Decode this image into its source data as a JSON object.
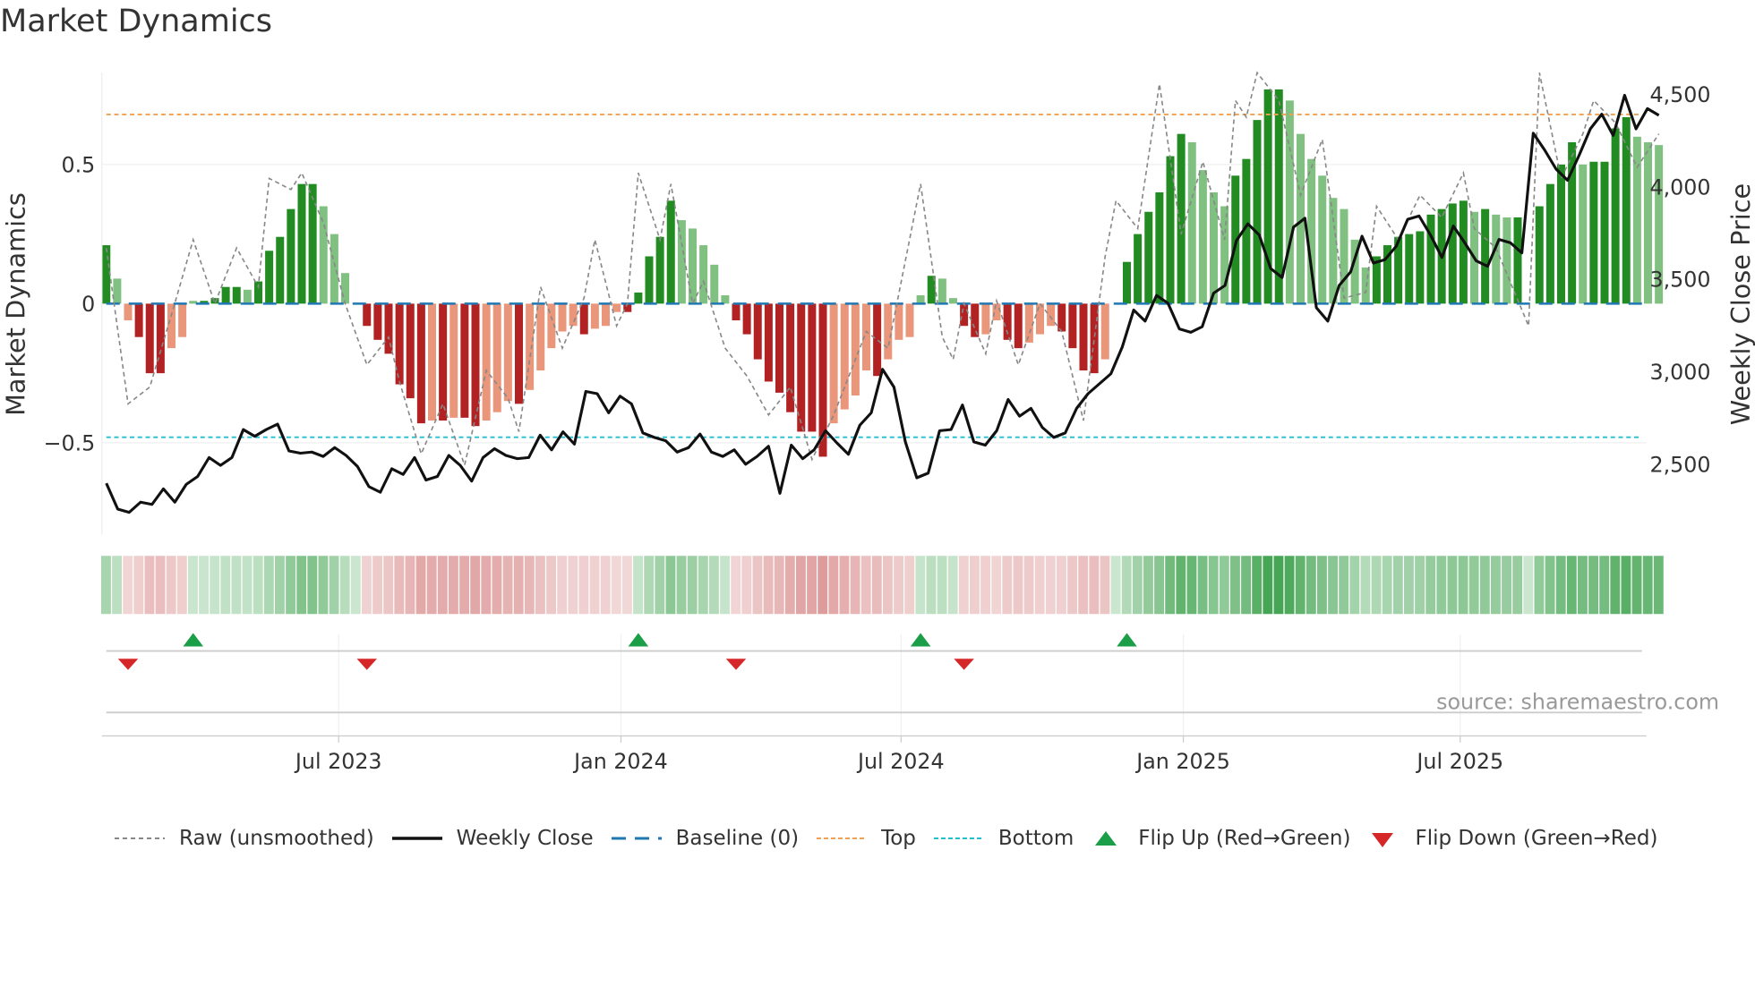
{
  "chart_data": {
    "type": "bar",
    "title": "Market Dynamics",
    "ylabel_left": "Market Dynamics",
    "ylabel_right": "Weekly Close Price",
    "ylim_left": [
      -0.83,
      0.83
    ],
    "ylim_right": [
      2120,
      4615
    ],
    "yticks_left": [
      {
        "v": 0.5,
        "label": "0.5"
      },
      {
        "v": 0,
        "label": "0"
      },
      {
        "v": -0.5,
        "label": "−0.5"
      }
    ],
    "yticks_right": [
      {
        "v": 4500,
        "label": "4,500"
      },
      {
        "v": 4000,
        "label": "4,000"
      },
      {
        "v": 3500,
        "label": "3,500"
      },
      {
        "v": 3000,
        "label": "3,000"
      },
      {
        "v": 2500,
        "label": "2,500"
      }
    ],
    "xticks": [
      {
        "week": 21.4,
        "label": "Jul 2023"
      },
      {
        "week": 47.4,
        "label": "Jan 2024"
      },
      {
        "week": 73.2,
        "label": "Jul 2024"
      },
      {
        "week": 99.2,
        "label": "Jan 2025"
      },
      {
        "week": 124.7,
        "label": "Jul 2025"
      }
    ],
    "top_level": 0.68,
    "bottom_level": -0.48,
    "baseline": 0,
    "momentum": [
      0.21,
      0.09,
      -0.06,
      -0.12,
      -0.25,
      -0.25,
      -0.16,
      -0.12,
      0.01,
      0.01,
      0.02,
      0.06,
      0.06,
      0.05,
      0.08,
      0.19,
      0.24,
      0.34,
      0.43,
      0.43,
      0.35,
      0.25,
      0.11,
      0,
      -0.08,
      -0.13,
      -0.18,
      -0.29,
      -0.34,
      -0.43,
      -0.42,
      -0.42,
      -0.41,
      -0.41,
      -0.44,
      -0.42,
      -0.39,
      -0.35,
      -0.36,
      -0.31,
      -0.24,
      -0.16,
      -0.1,
      -0.08,
      -0.11,
      -0.09,
      -0.08,
      -0.03,
      -0.03,
      0.04,
      0.17,
      0.24,
      0.37,
      0.3,
      0.27,
      0.21,
      0.14,
      0.03,
      -0.06,
      -0.11,
      -0.2,
      -0.28,
      -0.32,
      -0.39,
      -0.46,
      -0.46,
      -0.55,
      -0.43,
      -0.38,
      -0.33,
      -0.24,
      -0.26,
      -0.2,
      -0.13,
      -0.12,
      0.03,
      0.1,
      0.09,
      0.02,
      -0.08,
      -0.12,
      -0.11,
      -0.06,
      -0.13,
      -0.16,
      -0.14,
      -0.11,
      -0.08,
      -0.1,
      -0.16,
      -0.24,
      -0.25,
      -0.2,
      0,
      0.15,
      0.25,
      0.33,
      0.4,
      0.53,
      0.61,
      0.58,
      0.48,
      0.4,
      0.35,
      0.46,
      0.52,
      0.66,
      0.77,
      0.77,
      0.73,
      0.61,
      0.52,
      0.46,
      0.38,
      0.34,
      0.23,
      0.13,
      0.17,
      0.21,
      0.24,
      0.25,
      0.26,
      0.32,
      0.34,
      0.36,
      0.37,
      0.33,
      0.34,
      0.32,
      0.31,
      0.31,
      0.0,
      0.35,
      0.43,
      0.5,
      0.58,
      0.5,
      0.51,
      0.51,
      0.63,
      0.67,
      0.6,
      0.58,
      0.57
    ],
    "weekly_close": [
      2397,
      2258,
      2240,
      2295,
      2283,
      2367,
      2295,
      2391,
      2434,
      2536,
      2494,
      2536,
      2687,
      2651,
      2687,
      2717,
      2572,
      2560,
      2566,
      2542,
      2590,
      2548,
      2488,
      2379,
      2349,
      2476,
      2445,
      2536,
      2415,
      2434,
      2548,
      2494,
      2409,
      2536,
      2584,
      2548,
      2530,
      2536,
      2657,
      2578,
      2675,
      2609,
      2893,
      2881,
      2778,
      2868,
      2826,
      2669,
      2645,
      2627,
      2566,
      2590,
      2663,
      2566,
      2542,
      2578,
      2500,
      2542,
      2597,
      2343,
      2603,
      2530,
      2578,
      2681,
      2615,
      2554,
      2711,
      2778,
      3013,
      2917,
      2621,
      2427,
      2452,
      2681,
      2687,
      2820,
      2621,
      2603,
      2681,
      2850,
      2760,
      2802,
      2699,
      2645,
      2669,
      2802,
      2881,
      2935,
      2989,
      3134,
      3333,
      3273,
      3412,
      3370,
      3231,
      3213,
      3243,
      3424,
      3466,
      3708,
      3799,
      3738,
      3557,
      3509,
      3781,
      3829,
      3346,
      3273,
      3466,
      3539,
      3732,
      3587,
      3605,
      3678,
      3823,
      3841,
      3738,
      3617,
      3787,
      3696,
      3599,
      3569,
      3714,
      3696,
      3642,
      4288,
      4197,
      4094,
      4034,
      4167,
      4312,
      4391,
      4276,
      4493,
      4312,
      4421,
      4385
    ],
    "raw": [
      [
        0,
        0.2
      ],
      [
        2,
        -0.36
      ],
      [
        4,
        -0.3
      ],
      [
        6,
        -0.04
      ],
      [
        8,
        0.23
      ],
      [
        10,
        0
      ],
      [
        12,
        0.2
      ],
      [
        14,
        0.06
      ],
      [
        15,
        0.45
      ],
      [
        17,
        0.41
      ],
      [
        18,
        0.47
      ],
      [
        20,
        0.29
      ],
      [
        22,
        0
      ],
      [
        24,
        -0.22
      ],
      [
        26,
        -0.12
      ],
      [
        27,
        -0.28
      ],
      [
        29,
        -0.54
      ],
      [
        31,
        -0.36
      ],
      [
        33,
        -0.58
      ],
      [
        35,
        -0.24
      ],
      [
        37,
        -0.34
      ],
      [
        38,
        -0.46
      ],
      [
        40,
        0.06
      ],
      [
        42,
        -0.16
      ],
      [
        44,
        0.02
      ],
      [
        45,
        0.23
      ],
      [
        47,
        -0.08
      ],
      [
        48,
        0
      ],
      [
        49,
        0.47
      ],
      [
        51,
        0.23
      ],
      [
        52,
        0.43
      ],
      [
        54,
        0
      ],
      [
        55,
        0.08
      ],
      [
        57,
        -0.16
      ],
      [
        59,
        -0.26
      ],
      [
        61,
        -0.4
      ],
      [
        63,
        -0.3
      ],
      [
        65,
        -0.56
      ],
      [
        67,
        -0.4
      ],
      [
        69,
        -0.2
      ],
      [
        70,
        -0.1
      ],
      [
        72,
        -0.16
      ],
      [
        75,
        0.43
      ],
      [
        77,
        -0.12
      ],
      [
        78,
        -0.2
      ],
      [
        79,
        0
      ],
      [
        81,
        -0.18
      ],
      [
        82,
        0.01
      ],
      [
        84,
        -0.22
      ],
      [
        86,
        0
      ],
      [
        88,
        -0.1
      ],
      [
        90,
        -0.42
      ],
      [
        92,
        0.17
      ],
      [
        93,
        0.37
      ],
      [
        95,
        0.27
      ],
      [
        97,
        0.79
      ],
      [
        99,
        0.25
      ],
      [
        101,
        0.51
      ],
      [
        103,
        0.23
      ],
      [
        104,
        0.73
      ],
      [
        105,
        0.67
      ],
      [
        106,
        0.83
      ],
      [
        108,
        0.73
      ],
      [
        110,
        0.39
      ],
      [
        112,
        0.59
      ],
      [
        114,
        0.02
      ],
      [
        116,
        0.04
      ],
      [
        117,
        0.35
      ],
      [
        119,
        0.23
      ],
      [
        121,
        0.39
      ],
      [
        123,
        0.31
      ],
      [
        125,
        0.47
      ],
      [
        126,
        0.27
      ],
      [
        128,
        0.2
      ],
      [
        131,
        -0.08
      ],
      [
        132,
        0.83
      ],
      [
        134,
        0.45
      ],
      [
        136,
        0.61
      ],
      [
        137,
        0.73
      ],
      [
        139,
        0.65
      ],
      [
        141,
        0.49
      ],
      [
        143,
        0.61
      ]
    ],
    "flip_up_weeks": [
      8,
      49,
      75,
      94
    ],
    "flip_down_weeks": [
      2,
      24,
      58,
      79
    ],
    "colors": {
      "pos_strong": "#228b22",
      "pos_weak": "#80c080",
      "neg_strong": "#b22222",
      "neg_weak": "#e9967a",
      "top": "#f0a050",
      "bottom": "#20c0d0",
      "baseline": "#1f77b4",
      "flip_up": "#1a9e47",
      "flip_down": "#d62728"
    },
    "legend": [
      {
        "key": "raw",
        "label": "Raw (unsmoothed)"
      },
      {
        "key": "close",
        "label": "Weekly Close"
      },
      {
        "key": "baseline",
        "label": "Baseline (0)"
      },
      {
        "key": "top",
        "label": "Top"
      },
      {
        "key": "bottom",
        "label": "Bottom"
      },
      {
        "key": "flipup",
        "label": "Flip Up (Red→Green)"
      },
      {
        "key": "flipdown",
        "label": "Flip Down (Green→Red)"
      }
    ],
    "source": "source: sharemaestro.com"
  }
}
